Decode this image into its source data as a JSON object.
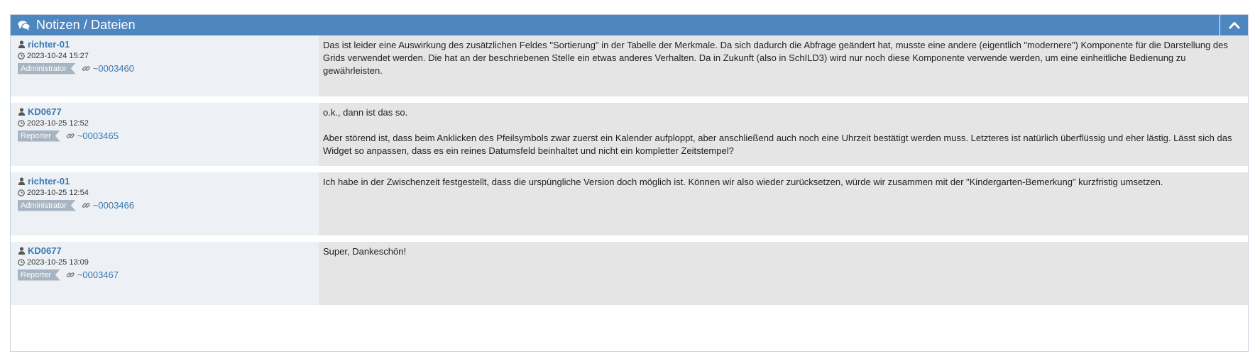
{
  "panel": {
    "title": "Notizen / Dateien",
    "header_color": "#4e86bf",
    "collapse_icon": "chevron-up-icon",
    "title_icon": "comments-icon"
  },
  "notes": [
    {
      "author": "richter-01",
      "timestamp": "2023-10-24 15:27",
      "role": "Administrator",
      "ref": "~0003460",
      "paragraphs": [
        "Das ist leider eine Auswirkung des zusätzlichen Feldes \"Sortierung\" in der Tabelle der Merkmale. Da sich dadurch die Abfrage geändert hat, musste eine andere (eigentlich \"modernere\") Komponente für die Darstellung des Grids verwendet werden. Die hat an der beschriebenen Stelle ein etwas anderes Verhalten. Da in Zukunft (also in SchILD3) wird nur noch diese Komponente verwende werden, um eine einheitliche Bedienung zu gewährleisten."
      ]
    },
    {
      "author": "KD0677",
      "timestamp": "2023-10-25 12:52",
      "role": "Reporter",
      "ref": "~0003465",
      "paragraphs": [
        "o.k., dann ist das so.",
        "Aber störend ist, dass beim Anklicken des Pfeilsymbols zwar zuerst ein Kalender aufploppt, aber anschließend auch noch eine Uhrzeit bestätigt werden muss. Letzteres ist natürlich überflüssig und eher lästig. Lässt sich das Widget so anpassen, dass es ein reines Datumsfeld beinhaltet und nicht ein kompletter Zeitstempel?"
      ]
    },
    {
      "author": "richter-01",
      "timestamp": "2023-10-25 12:54",
      "role": "Administrator",
      "ref": "~0003466",
      "paragraphs": [
        "Ich habe in der Zwischenzeit festgestellt, dass die urspüngliche Version doch möglich ist. Können wir also wieder zurücksetzen, würde wir zusammen mit der \"Kindergarten-Bemerkung\" kurzfristig umsetzen."
      ]
    },
    {
      "author": "KD0677",
      "timestamp": "2023-10-25 13:09",
      "role": "Reporter",
      "ref": "~0003467",
      "paragraphs": [
        "Super, Dankeschön!"
      ]
    }
  ]
}
